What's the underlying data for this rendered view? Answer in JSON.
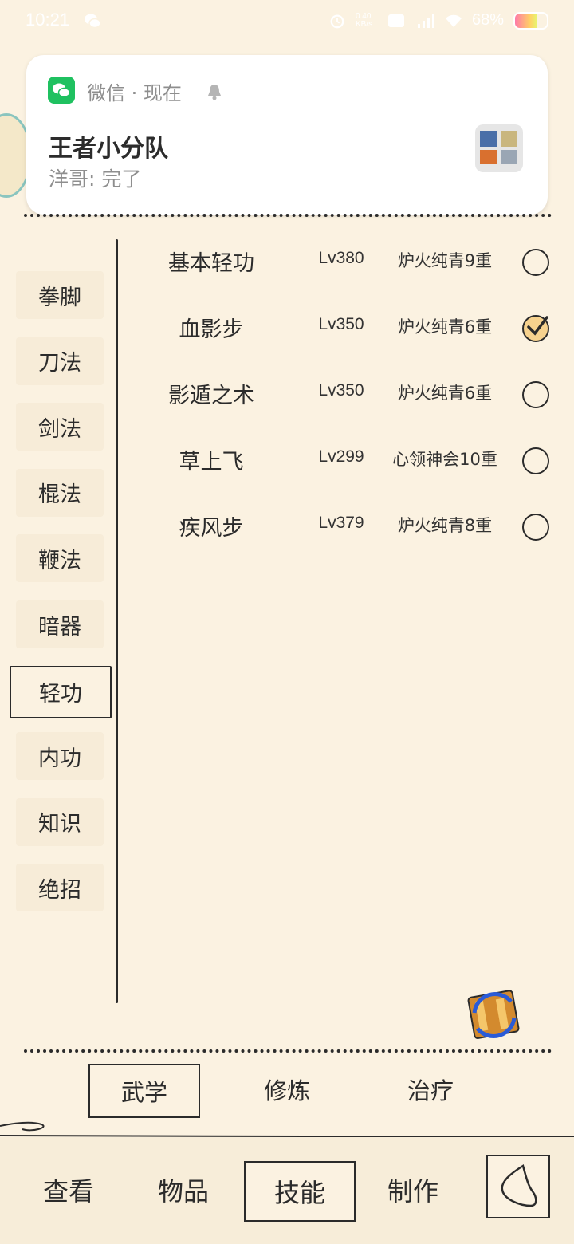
{
  "status_bar": {
    "time": "10:21",
    "net_speed": "0.40 KB/s",
    "battery": "68%",
    "battery_level": 0.68,
    "icons": [
      "wechat-icon",
      "alarm-icon",
      "hd-icon",
      "4g-signal-icon",
      "wifi-icon",
      "battery-icon"
    ]
  },
  "notification": {
    "app_name": "微信 · 现在",
    "title": "王者小分队",
    "message": "洋哥: 完了",
    "app_color": "#1fc160"
  },
  "categories": [
    {
      "label": "拳脚",
      "selected": false
    },
    {
      "label": "刀法",
      "selected": false
    },
    {
      "label": "剑法",
      "selected": false
    },
    {
      "label": "棍法",
      "selected": false
    },
    {
      "label": "鞭法",
      "selected": false
    },
    {
      "label": "暗器",
      "selected": false
    },
    {
      "label": "轻功",
      "selected": true
    },
    {
      "label": "内功",
      "selected": false
    },
    {
      "label": "知识",
      "selected": false
    },
    {
      "label": "绝招",
      "selected": false
    }
  ],
  "skills": [
    {
      "name": "基本轻功",
      "level": "Lv380",
      "progress": "炉火纯青9重",
      "checked": false
    },
    {
      "name": "血影步",
      "level": "Lv350",
      "progress": "炉火纯青6重",
      "checked": true
    },
    {
      "name": "影遁之术",
      "level": "Lv350",
      "progress": "炉火纯青6重",
      "checked": false
    },
    {
      "name": "草上飞",
      "level": "Lv299",
      "progress": "心领神会10重",
      "checked": false
    },
    {
      "name": "疾风步",
      "level": "Lv379",
      "progress": "炉火纯青8重",
      "checked": false
    }
  ],
  "sub_tabs": [
    {
      "label": "武学",
      "selected": true
    },
    {
      "label": "修炼",
      "selected": false
    },
    {
      "label": "治疗",
      "selected": false
    }
  ],
  "bottom_nav": [
    {
      "label": "查看",
      "selected": false
    },
    {
      "label": "物品",
      "selected": false
    },
    {
      "label": "技能",
      "selected": true
    },
    {
      "label": "制作",
      "selected": false
    }
  ],
  "colors": {
    "background": "#fbf2e1",
    "ink": "#2b2b2b",
    "check_fill": "#f6d28e"
  }
}
